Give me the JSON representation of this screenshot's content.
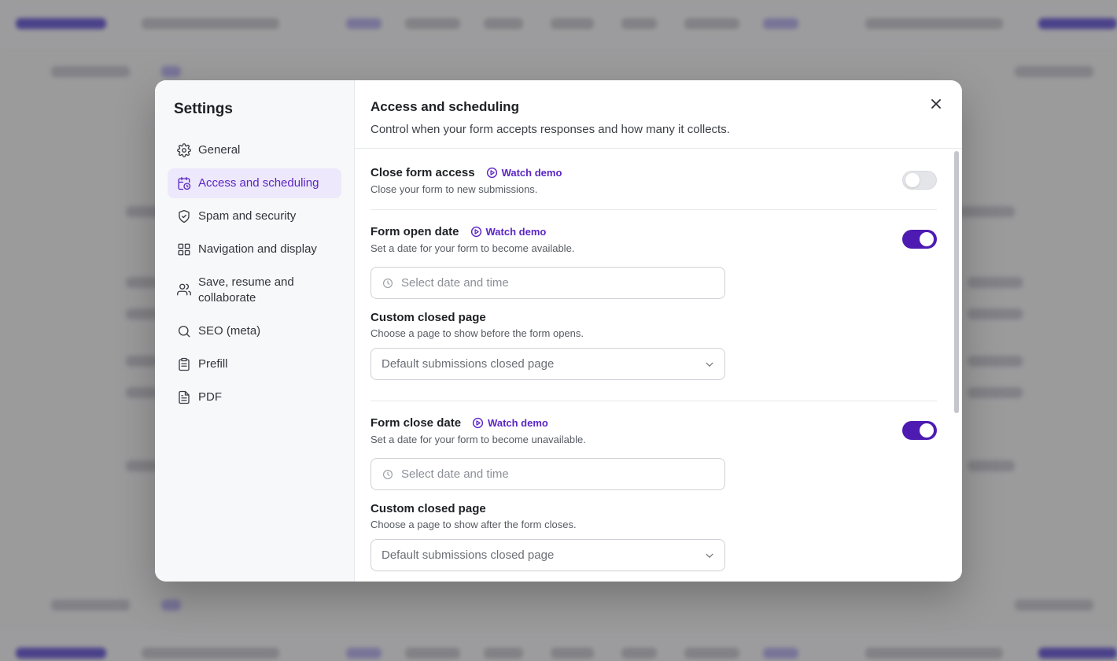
{
  "sidebar": {
    "title": "Settings",
    "items": [
      {
        "label": "General",
        "icon": "gear-icon"
      },
      {
        "label": "Access and scheduling",
        "icon": "calendar-clock-icon",
        "active": true
      },
      {
        "label": "Spam and security",
        "icon": "shield-icon"
      },
      {
        "label": "Navigation and display",
        "icon": "grid-icon"
      },
      {
        "label": "Save, resume and collaborate",
        "icon": "users-icon"
      },
      {
        "label": "SEO (meta)",
        "icon": "search-icon"
      },
      {
        "label": "Prefill",
        "icon": "clipboard-icon"
      },
      {
        "label": "PDF",
        "icon": "document-icon"
      }
    ]
  },
  "header": {
    "title": "Access and scheduling",
    "subtitle": "Control when your form accepts responses and how many it collects."
  },
  "sections": {
    "close_access": {
      "title": "Close form access",
      "demo": "Watch demo",
      "desc": "Close your form to new submissions.",
      "enabled": false
    },
    "open_date": {
      "title": "Form open date",
      "demo": "Watch demo",
      "desc": "Set a date for your form to become available.",
      "enabled": true,
      "date_placeholder": "Select date and time",
      "page_label": "Custom closed page",
      "page_desc": "Choose a page to show before the form opens.",
      "page_value": "Default submissions closed page"
    },
    "close_date": {
      "title": "Form close date",
      "demo": "Watch demo",
      "desc": "Set a date for your form to become unavailable.",
      "enabled": true,
      "date_placeholder": "Select date and time",
      "page_label": "Custom closed page",
      "page_desc": "Choose a page to show after the form closes.",
      "page_value": "Default submissions closed page"
    }
  },
  "colors": {
    "accent": "#5b25c4",
    "toggle_on": "#4d1bb2",
    "active_nav_bg": "#ede8fb"
  }
}
